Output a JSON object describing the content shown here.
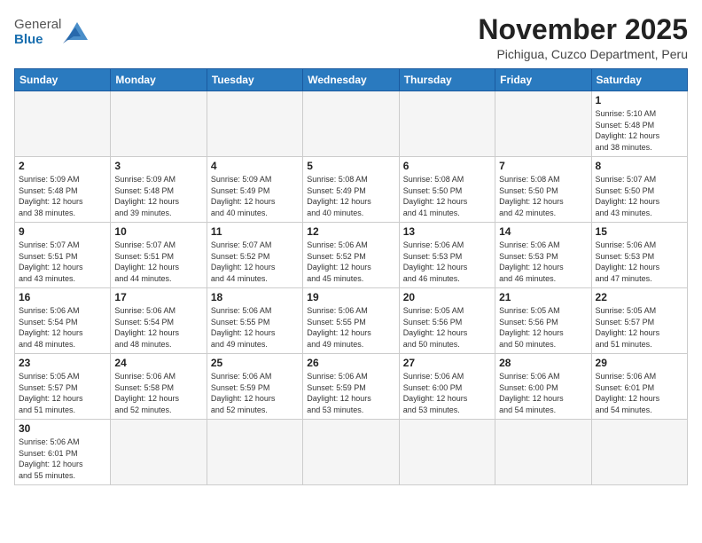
{
  "header": {
    "logo_general": "General",
    "logo_blue": "Blue",
    "title": "November 2025",
    "subtitle": "Pichigua, Cuzco Department, Peru"
  },
  "days_of_week": [
    "Sunday",
    "Monday",
    "Tuesday",
    "Wednesday",
    "Thursday",
    "Friday",
    "Saturday"
  ],
  "weeks": [
    [
      {
        "day": "",
        "info": ""
      },
      {
        "day": "",
        "info": ""
      },
      {
        "day": "",
        "info": ""
      },
      {
        "day": "",
        "info": ""
      },
      {
        "day": "",
        "info": ""
      },
      {
        "day": "",
        "info": ""
      },
      {
        "day": "1",
        "info": "Sunrise: 5:10 AM\nSunset: 5:48 PM\nDaylight: 12 hours\nand 38 minutes."
      }
    ],
    [
      {
        "day": "2",
        "info": "Sunrise: 5:09 AM\nSunset: 5:48 PM\nDaylight: 12 hours\nand 38 minutes."
      },
      {
        "day": "3",
        "info": "Sunrise: 5:09 AM\nSunset: 5:48 PM\nDaylight: 12 hours\nand 39 minutes."
      },
      {
        "day": "4",
        "info": "Sunrise: 5:09 AM\nSunset: 5:49 PM\nDaylight: 12 hours\nand 40 minutes."
      },
      {
        "day": "5",
        "info": "Sunrise: 5:08 AM\nSunset: 5:49 PM\nDaylight: 12 hours\nand 40 minutes."
      },
      {
        "day": "6",
        "info": "Sunrise: 5:08 AM\nSunset: 5:50 PM\nDaylight: 12 hours\nand 41 minutes."
      },
      {
        "day": "7",
        "info": "Sunrise: 5:08 AM\nSunset: 5:50 PM\nDaylight: 12 hours\nand 42 minutes."
      },
      {
        "day": "8",
        "info": "Sunrise: 5:07 AM\nSunset: 5:50 PM\nDaylight: 12 hours\nand 43 minutes."
      }
    ],
    [
      {
        "day": "9",
        "info": "Sunrise: 5:07 AM\nSunset: 5:51 PM\nDaylight: 12 hours\nand 43 minutes."
      },
      {
        "day": "10",
        "info": "Sunrise: 5:07 AM\nSunset: 5:51 PM\nDaylight: 12 hours\nand 44 minutes."
      },
      {
        "day": "11",
        "info": "Sunrise: 5:07 AM\nSunset: 5:52 PM\nDaylight: 12 hours\nand 44 minutes."
      },
      {
        "day": "12",
        "info": "Sunrise: 5:06 AM\nSunset: 5:52 PM\nDaylight: 12 hours\nand 45 minutes."
      },
      {
        "day": "13",
        "info": "Sunrise: 5:06 AM\nSunset: 5:53 PM\nDaylight: 12 hours\nand 46 minutes."
      },
      {
        "day": "14",
        "info": "Sunrise: 5:06 AM\nSunset: 5:53 PM\nDaylight: 12 hours\nand 46 minutes."
      },
      {
        "day": "15",
        "info": "Sunrise: 5:06 AM\nSunset: 5:53 PM\nDaylight: 12 hours\nand 47 minutes."
      }
    ],
    [
      {
        "day": "16",
        "info": "Sunrise: 5:06 AM\nSunset: 5:54 PM\nDaylight: 12 hours\nand 48 minutes."
      },
      {
        "day": "17",
        "info": "Sunrise: 5:06 AM\nSunset: 5:54 PM\nDaylight: 12 hours\nand 48 minutes."
      },
      {
        "day": "18",
        "info": "Sunrise: 5:06 AM\nSunset: 5:55 PM\nDaylight: 12 hours\nand 49 minutes."
      },
      {
        "day": "19",
        "info": "Sunrise: 5:06 AM\nSunset: 5:55 PM\nDaylight: 12 hours\nand 49 minutes."
      },
      {
        "day": "20",
        "info": "Sunrise: 5:05 AM\nSunset: 5:56 PM\nDaylight: 12 hours\nand 50 minutes."
      },
      {
        "day": "21",
        "info": "Sunrise: 5:05 AM\nSunset: 5:56 PM\nDaylight: 12 hours\nand 50 minutes."
      },
      {
        "day": "22",
        "info": "Sunrise: 5:05 AM\nSunset: 5:57 PM\nDaylight: 12 hours\nand 51 minutes."
      }
    ],
    [
      {
        "day": "23",
        "info": "Sunrise: 5:05 AM\nSunset: 5:57 PM\nDaylight: 12 hours\nand 51 minutes."
      },
      {
        "day": "24",
        "info": "Sunrise: 5:06 AM\nSunset: 5:58 PM\nDaylight: 12 hours\nand 52 minutes."
      },
      {
        "day": "25",
        "info": "Sunrise: 5:06 AM\nSunset: 5:59 PM\nDaylight: 12 hours\nand 52 minutes."
      },
      {
        "day": "26",
        "info": "Sunrise: 5:06 AM\nSunset: 5:59 PM\nDaylight: 12 hours\nand 53 minutes."
      },
      {
        "day": "27",
        "info": "Sunrise: 5:06 AM\nSunset: 6:00 PM\nDaylight: 12 hours\nand 53 minutes."
      },
      {
        "day": "28",
        "info": "Sunrise: 5:06 AM\nSunset: 6:00 PM\nDaylight: 12 hours\nand 54 minutes."
      },
      {
        "day": "29",
        "info": "Sunrise: 5:06 AM\nSunset: 6:01 PM\nDaylight: 12 hours\nand 54 minutes."
      }
    ],
    [
      {
        "day": "30",
        "info": "Sunrise: 5:06 AM\nSunset: 6:01 PM\nDaylight: 12 hours\nand 55 minutes."
      },
      {
        "day": "",
        "info": ""
      },
      {
        "day": "",
        "info": ""
      },
      {
        "day": "",
        "info": ""
      },
      {
        "day": "",
        "info": ""
      },
      {
        "day": "",
        "info": ""
      },
      {
        "day": "",
        "info": ""
      }
    ]
  ]
}
